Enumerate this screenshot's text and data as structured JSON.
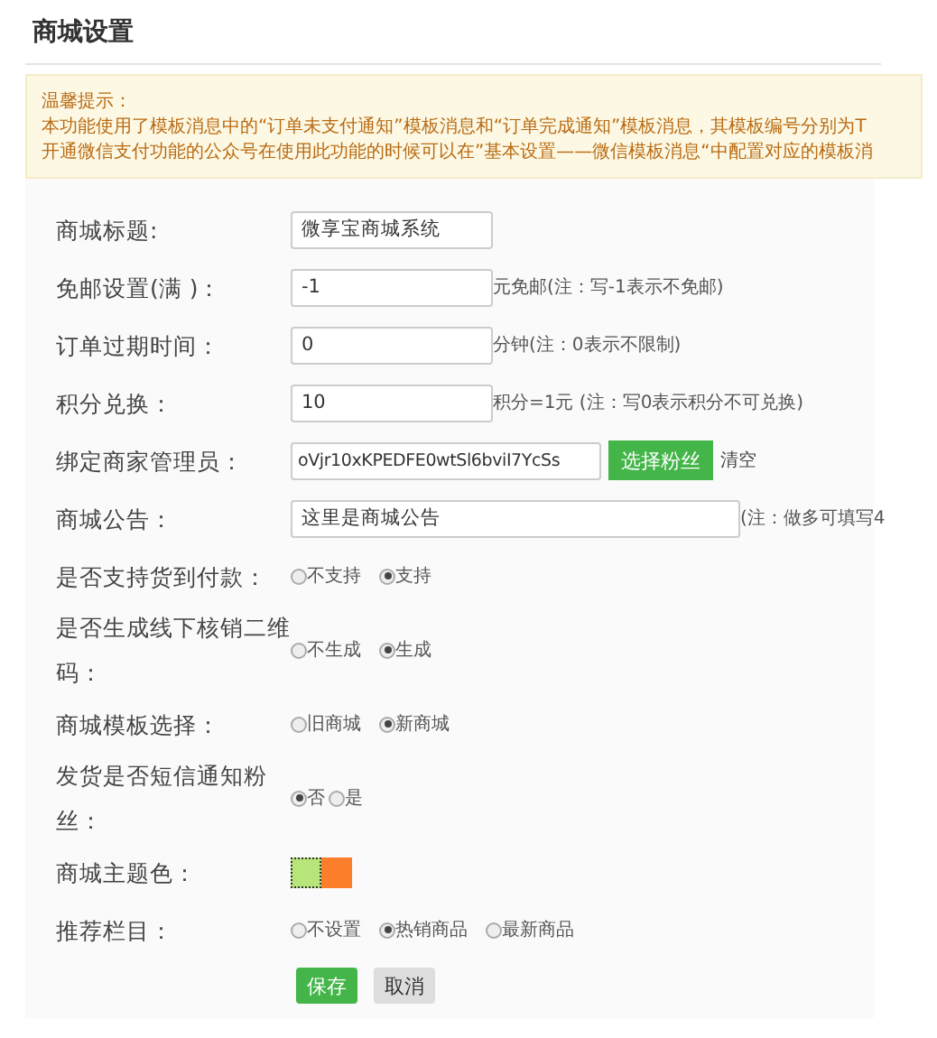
{
  "page_title": "商城设置",
  "notice": {
    "title": "温馨提示：",
    "lines": [
      "本功能使用了模板消息中的“订单未支付通知”模板消息和“订单完成通知”模板消息，其模板编号分别为T",
      "开通微信支付功能的公众号在使用此功能的时候可以在”基本设置——微信模板消息“中配置对应的模板消"
    ]
  },
  "form": [
    {
      "kind": "text",
      "label": "商城标题:",
      "value": "微享宝商城系统"
    },
    {
      "kind": "text",
      "label": "免邮设置(满 )：",
      "value": "-1",
      "note": "元免邮(注：写-1表示不免邮)"
    },
    {
      "kind": "text",
      "label": "订单过期时间：",
      "value": "0",
      "note": "分钟(注：0表示不限制)"
    },
    {
      "kind": "text",
      "label": "积分兑换：",
      "value": "10",
      "note": "积分=1元 (注：写0表示积分不可兑换)"
    },
    {
      "kind": "pick",
      "label": "绑定商家管理员：",
      "value": "oVjr10xKPEDFE0wtSl6bviI7YcSs",
      "button": "选择粉丝",
      "link": "清空"
    },
    {
      "kind": "long_text",
      "label": "商城公告：",
      "value": "这里是商城公告",
      "note": "(注：做多可填写4"
    },
    {
      "kind": "radio",
      "label": "是否支持货到付款：",
      "options": [
        {
          "label": "不支持",
          "selected": false
        },
        {
          "label": "支持",
          "selected": true
        }
      ]
    },
    {
      "kind": "radio",
      "label": "是否生成线下核销二维码：",
      "options": [
        {
          "label": "不生成",
          "selected": false
        },
        {
          "label": "生成",
          "selected": true
        }
      ]
    },
    {
      "kind": "radio",
      "label": "商城模板选择：",
      "options": [
        {
          "label": "旧商城",
          "selected": false
        },
        {
          "label": "新商城",
          "selected": true
        }
      ]
    },
    {
      "kind": "radio_tight",
      "label": "发货是否短信通知粉丝：",
      "options": [
        {
          "label": "否",
          "selected": true
        },
        {
          "label": "是",
          "selected": false
        }
      ]
    },
    {
      "kind": "color",
      "label": "商城主题色：",
      "swatches": [
        {
          "color": "#b7e57a",
          "selected": true
        },
        {
          "color": "#fc7d2a",
          "selected": false
        }
      ]
    },
    {
      "kind": "radio",
      "label": "推荐栏目：",
      "options": [
        {
          "label": "不设置",
          "selected": false
        },
        {
          "label": "热销商品",
          "selected": true
        },
        {
          "label": "最新商品",
          "selected": false
        }
      ]
    }
  ],
  "buttons": [
    {
      "label": "保存",
      "kind": "primary"
    },
    {
      "label": "取消",
      "kind": "default"
    }
  ]
}
